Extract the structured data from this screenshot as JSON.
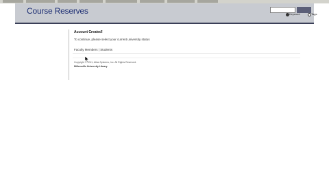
{
  "app": {
    "title": "Course Reserves"
  },
  "search": {
    "input_value": "",
    "button_label": "",
    "options": [
      "Keyword",
      "Tags"
    ],
    "selected": "Keyword"
  },
  "content": {
    "heading": "Account Created!",
    "instruction": "To continue, please select your current university status",
    "status_links": [
      "Faculty Members",
      "Students"
    ],
    "separator": "|"
  },
  "footer": {
    "copyright": "Copyright © 2011, Atlas Systems, Inc. All Rights Reserved.",
    "library": "Millersville University Library"
  },
  "colors": {
    "title": "#1e2f74",
    "header_bg": "#c8cbd1",
    "header_rule": "#3a3f58",
    "search_button": "#5b5f78"
  }
}
